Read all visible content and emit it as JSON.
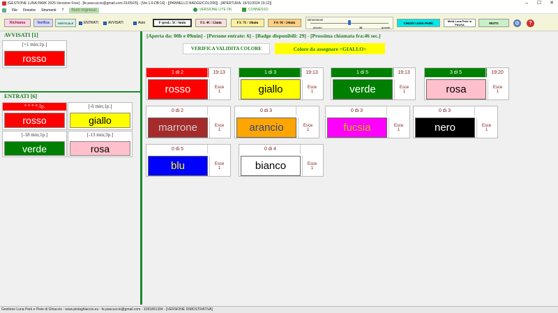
{
  "window": {
    "title": "[GESTIONE LUNA PARK 2025-Versione Free] - [fe.pascuccio@gmail.com-31/05/25] - [Ver.1.0-DB:16] - [[PANNELLO BADGE/COLORI]] - [APERTURA: 16/11/2024 19:12]]",
    "btn_minimize": "–",
    "btn_maximize": "☐",
    "btn_close": "✕"
  },
  "menu": {
    "items": [
      "File",
      "Finestre",
      "Strumenti",
      "?"
    ],
    "num_ingressi": "Num Ingressi:",
    "status_lite": "VERSIONE LITE OK",
    "status_conn": "CONNESSO"
  },
  "toolbar": {
    "richiama": "Richiama",
    "verifica": "Verifica",
    "verticale": "VERTICALE",
    "entrati": "ENTRATI",
    "avvisati": "AVVISATI",
    "auto": "Auto",
    "f_pred": "F-pred.: 5€ / 6min",
    "f2": "F2: 4€ / 12min",
    "f3": "F3: 7€ / 18min",
    "f4": "F4: 9€ / 24min",
    "dimensioni": "Dimensioni",
    "slider_min": "piccolo",
    "slider_value": "16",
    "slider_max": "grande",
    "chiudi": "CHIUDI LUNA PARK",
    "metti_pausa": "Metti Luna Park in PAUSA",
    "muto": "MUTO"
  },
  "left": {
    "avvisati_title": "AVVISATI [1]",
    "entrati_title": "ENTRATI [6]",
    "avvisati_cards": [
      {
        "header": "[+1 min;1p.]",
        "color": "rosso",
        "bg": "#ff0000",
        "fg": "#ffffff"
      }
    ],
    "entrati_cards": [
      {
        "header": "* * * *.1p.",
        "color": "rosso",
        "bg": "#ff0000",
        "fg": "#ffffff",
        "header_bg": "#ff0000",
        "header_fg": "#ffffff"
      },
      {
        "header": "[-6 min;1p.]",
        "color": "giallo",
        "bg": "#ffff00",
        "fg": "#000000"
      },
      {
        "header": "[-18 min;1p.]",
        "color": "verde",
        "bg": "#008000",
        "fg": "#ffffff"
      },
      {
        "header": "[-13 min;3p.]",
        "color": "rosa",
        "bg": "#ffc0cb",
        "fg": "#000000"
      }
    ]
  },
  "main": {
    "info": "[Aperta da: 00h e 09min] - [Persone entrate: 6] - [Badge disponibili: 29] - [Prossima chiamata fra:46 sec.]",
    "verifica_btn": "VERIFICA VALIDITA COLORE",
    "assign": "Colore da assegnare <GIALLO>",
    "esce_label": "Esce",
    "cards": [
      {
        "count": "1 di 2",
        "time": "19:13",
        "color": "rosso",
        "bg": "#ff0000",
        "fg": "#ffffff",
        "head_bg": "#ff0000",
        "head_fg": "#ffffff",
        "esce": "1"
      },
      {
        "count": "1 di 3",
        "time": "19:13",
        "color": "giallo",
        "bg": "#ffff00",
        "fg": "#000000",
        "head_bg": "#008000",
        "head_fg": "#ffffff",
        "esce": "1"
      },
      {
        "count": "1 di 5",
        "time": "19:13",
        "color": "verde",
        "bg": "#008000",
        "fg": "#ffffff",
        "head_bg": "#008000",
        "head_fg": "#ffffff",
        "esce": "1"
      },
      {
        "count": "3 di 5",
        "time": "19:20",
        "color": "rosa",
        "bg": "#ffc0cb",
        "fg": "#000000",
        "head_bg": "#008000",
        "head_fg": "#ffffff",
        "esce": "1"
      },
      {
        "count": "0 di 2",
        "time": "",
        "color": "marrone",
        "bg": "#a52a2a",
        "fg": "#d0d0d0",
        "head_bg": "#ffffff",
        "head_fg": "#7a1a1a",
        "esce": "1"
      },
      {
        "count": "0 di 3",
        "time": "",
        "color": "arancio",
        "bg": "#ffa500",
        "fg": "#2a4a8a",
        "head_bg": "#ffffff",
        "head_fg": "#7a1a1a",
        "esce": "1"
      },
      {
        "count": "0 di 3",
        "time": "",
        "color": "fucsia",
        "bg": "#ff00ff",
        "fg": "#c0c000",
        "head_bg": "#ffffff",
        "head_fg": "#7a1a1a",
        "esce": "1"
      },
      {
        "count": "0 di 3",
        "time": "",
        "color": "nero",
        "bg": "#000000",
        "fg": "#ffffff",
        "head_bg": "#ffffff",
        "head_fg": "#7a1a1a",
        "esce": "1"
      },
      {
        "count": "0 di 5",
        "time": "",
        "color": "blu",
        "bg": "#0000ff",
        "fg": "#ffff00",
        "head_bg": "#ffffff",
        "head_fg": "#7a1a1a",
        "esce": "1"
      },
      {
        "count": "0 di 4",
        "time": "",
        "color": "bianco",
        "bg": "#ffffff",
        "fg": "#000000",
        "head_bg": "#ffffff",
        "head_fg": "#7a1a1a",
        "esce": "1"
      }
    ]
  },
  "footer": "Gestione Luna Park e Piste di Ghiaccio - www.pistaghiaccio.eu - fe.pascuccio@gmail.com - 3281801394 - [VERSIONE DIMOSTRATIVA]"
}
